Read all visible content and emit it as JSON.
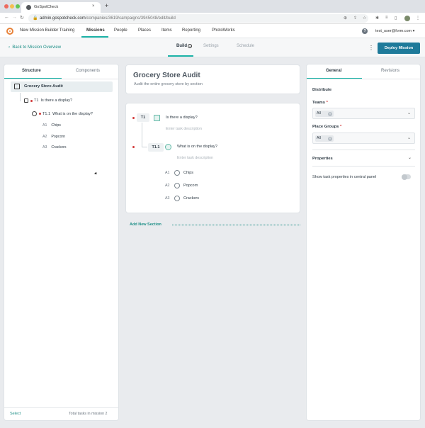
{
  "browser": {
    "tab_title": "GoSpotCheck",
    "tab_close": "×",
    "new_tab": "+",
    "url_host": "admin.gospotcheck.com",
    "url_path": "/companies/3619/campaigns/3945048/edit/build"
  },
  "appnav": {
    "items": [
      "New Mission Builder Training",
      "Missions",
      "People",
      "Places",
      "Items",
      "Reporting",
      "PhotoWorks"
    ],
    "user": "test_user@form.com ▾",
    "help": "?"
  },
  "subheader": {
    "back": "Back to Mission Overview",
    "tabs": [
      "Build",
      "Settings",
      "Schedule"
    ],
    "build_badge": "i",
    "deploy": "Deploy Mission"
  },
  "left_panel": {
    "tabs": [
      "Structure",
      "Components"
    ],
    "root": "Grocery Store Audit",
    "t1_code": "T1",
    "t1_label": "Is there a display?",
    "t11_code": "T1.1",
    "t11_label": "What is on the display?",
    "options": [
      {
        "code": "A1",
        "label": "Chips"
      },
      {
        "code": "A2",
        "label": "Popcorn"
      },
      {
        "code": "A3",
        "label": "Crackers"
      }
    ],
    "select": "Select",
    "total": "Total tasks in mission 2"
  },
  "center": {
    "title": "Grocery Store Audit",
    "subtitle": "Audit the entire grocery store by section",
    "t1_num": "T1",
    "t1_title": "Is there a display?",
    "t1_desc": "Enter task description",
    "t11_num": "T1.1",
    "t11_title": "What is on the display?",
    "t11_desc": "Enter task description",
    "options": [
      {
        "code": "A1",
        "label": "Chips"
      },
      {
        "code": "A2",
        "label": "Popcorn"
      },
      {
        "code": "A3",
        "label": "Crackers"
      }
    ],
    "add_section": "Add New Section"
  },
  "right_panel": {
    "tabs": [
      "General",
      "Revisions"
    ],
    "distribute": "Distribute",
    "teams_label": "Teams",
    "teams_value": "All",
    "place_groups_label": "Place Groups",
    "place_groups_value": "All",
    "required_mark": "*",
    "properties": "Properties",
    "show_props": "Show task properties in central panel"
  },
  "colors": {
    "accent": "#1db3a7",
    "deploy": "#1e7a9a",
    "required": "#d23a3a"
  }
}
